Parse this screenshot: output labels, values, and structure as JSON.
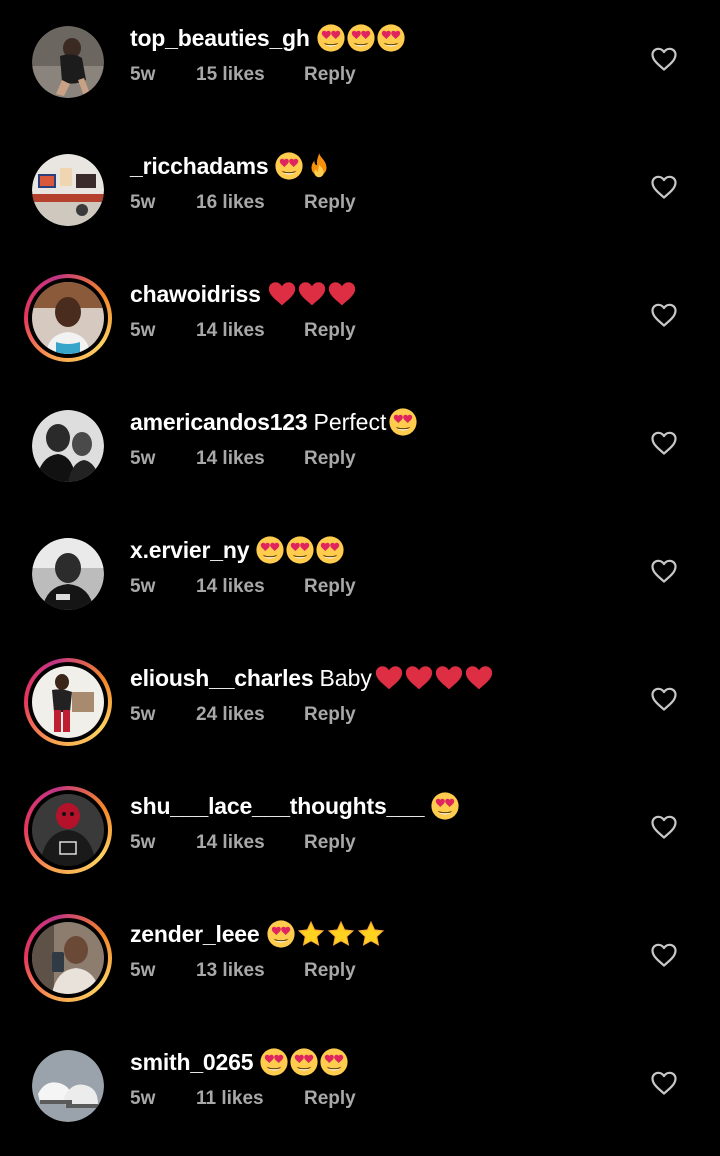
{
  "comments": [
    {
      "username": "top_beauties_gh",
      "text": "",
      "emojis": [
        "heart-eyes",
        "heart-eyes",
        "heart-eyes"
      ],
      "time": "5w",
      "likes": "15 likes",
      "reply": "Reply",
      "story_ring": false,
      "avatar": "woman-pose"
    },
    {
      "username": "_ricchadams",
      "text": "",
      "emojis": [
        "heart-eyes",
        "fire"
      ],
      "time": "5w",
      "likes": "16 likes",
      "reply": "Reply",
      "story_ring": false,
      "avatar": "room-wall"
    },
    {
      "username": "chawoidriss",
      "text": "",
      "emojis": [
        "red-heart",
        "red-heart",
        "red-heart"
      ],
      "time": "5w",
      "likes": "14 likes",
      "reply": "Reply",
      "story_ring": true,
      "avatar": "man-portrait"
    },
    {
      "username": "americandos123",
      "text": "Perfect",
      "emojis": [
        "heart-eyes"
      ],
      "time": "5w",
      "likes": "14 likes",
      "reply": "Reply",
      "story_ring": false,
      "avatar": "bw-couple"
    },
    {
      "username": "x.ervier_ny",
      "text": "",
      "emojis": [
        "heart-eyes",
        "heart-eyes",
        "heart-eyes"
      ],
      "time": "5w",
      "likes": "14 likes",
      "reply": "Reply",
      "story_ring": false,
      "avatar": "bw-man"
    },
    {
      "username": "elioush__charles",
      "text": "Baby",
      "emojis": [
        "red-heart",
        "red-heart",
        "red-heart",
        "red-heart"
      ],
      "time": "5w",
      "likes": "24 likes",
      "reply": "Reply",
      "story_ring": true,
      "avatar": "man-red-outfit"
    },
    {
      "username": "shu___lace___thoughts___",
      "text": "",
      "emojis": [
        "heart-eyes"
      ],
      "time": "5w",
      "likes": "14 likes",
      "reply": "Reply",
      "story_ring": true,
      "avatar": "red-mask"
    },
    {
      "username": "zender_leee",
      "text": "",
      "emojis": [
        "heart-eyes",
        "star",
        "star",
        "star"
      ],
      "time": "5w",
      "likes": "13 likes",
      "reply": "Reply",
      "story_ring": true,
      "avatar": "mirror-selfie"
    },
    {
      "username": "smith_0265",
      "text": "",
      "emojis": [
        "heart-eyes",
        "heart-eyes",
        "heart-eyes"
      ],
      "time": "5w",
      "likes": "11 likes",
      "reply": "Reply",
      "story_ring": false,
      "avatar": "white-sneakers"
    }
  ],
  "colors": {
    "background": "#000000",
    "username": "#ffffff",
    "meta": "#a8a8a8",
    "heart_outline": "#c7c7c7"
  }
}
